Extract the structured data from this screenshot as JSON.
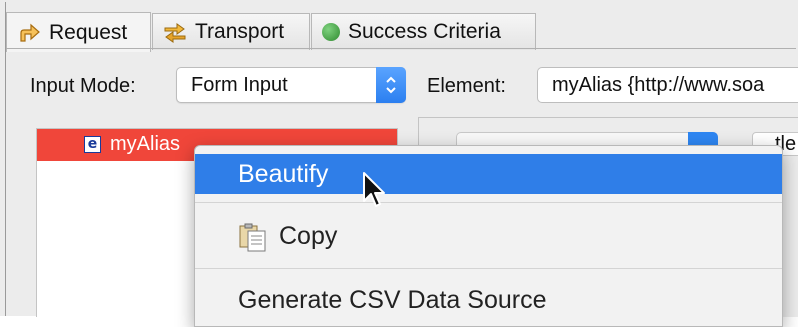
{
  "tabs": [
    {
      "label": "Request",
      "icon": "arrow-up-icon",
      "active": true
    },
    {
      "label": "Transport",
      "icon": "transport-arrows-icon",
      "active": false
    },
    {
      "label": "Success Criteria",
      "icon": "green-dot-icon",
      "active": false
    }
  ],
  "form": {
    "input_mode_label": "Input Mode:",
    "input_mode_value": "Form Input",
    "element_label": "Element:",
    "element_value": "myAlias {http://www.soa"
  },
  "tree": {
    "selected_item": "myAlias",
    "item_icon_letter": "e"
  },
  "right_panel": {
    "partial_text": "tle"
  },
  "context_menu": {
    "items": [
      {
        "label": "Beautify",
        "highlighted": true
      },
      {
        "label": "Copy",
        "icon": "copy-clipboard-icon",
        "highlighted": false
      },
      {
        "label": "Generate CSV Data Source",
        "highlighted": false
      }
    ]
  },
  "colors": {
    "selection_red": "#f0463a",
    "menu_highlight": "#2f7ee8",
    "stepper_blue": "#2b7ff0",
    "success_green": "#3a9a3a"
  }
}
